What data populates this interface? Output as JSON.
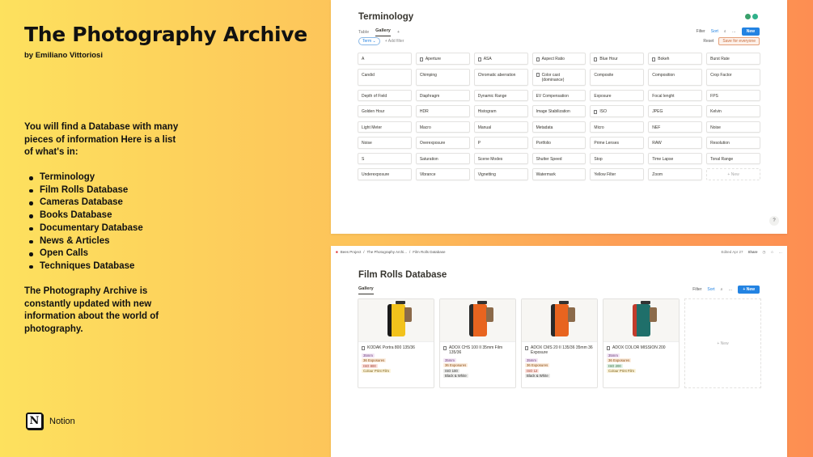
{
  "slide": {
    "title": "The Photography Archive",
    "byline": "by Emiliano Vittoriosi",
    "intro": "You will find a Database with many pieces of information Here is a list of what's in:",
    "items": [
      "Terminology",
      "Film Rolls Database",
      "Cameras Database",
      "Books Database",
      "Documentary Database",
      "News & Articles",
      "Open Calls",
      "Techniques Database"
    ],
    "outro": "The Photography Archive is constantly updated with new information about the world of photography.",
    "brand": "Notion"
  },
  "terminology": {
    "title": "Terminology",
    "tabs": [
      "Table",
      "Gallery",
      "+"
    ],
    "filter": "Filter",
    "sort": "Sort",
    "new": "New",
    "chip": "Term ⌄",
    "add_filter": "+ Add filter",
    "reset": "Reset",
    "save": "Save for everyone",
    "cards": [
      [
        "A",
        0
      ],
      [
        "Aperture",
        1
      ],
      [
        "ASA",
        1
      ],
      [
        "Aspect Ratio",
        1
      ],
      [
        "Blue Hour",
        1
      ],
      [
        "Bokeh",
        1
      ],
      [
        "Burst Rate",
        0
      ],
      [
        "Candid",
        0
      ],
      [
        "Chimping",
        0
      ],
      [
        "Chromatic aberration",
        0
      ],
      [
        "Color cast (dominance)",
        1
      ],
      [
        "Composite",
        0
      ],
      [
        "Composition",
        0
      ],
      [
        "Crop Factor",
        0
      ],
      [
        "Depth of Field",
        0
      ],
      [
        "Diaphragm",
        0
      ],
      [
        "Dynamic Range",
        0
      ],
      [
        "EV Compensation",
        0
      ],
      [
        "Exposure",
        0
      ],
      [
        "Focal lenght",
        0
      ],
      [
        "FPS",
        0
      ],
      [
        "Golden Hour",
        0
      ],
      [
        "HDR",
        0
      ],
      [
        "Histogram",
        0
      ],
      [
        "Image Stabilization",
        0
      ],
      [
        "ISO",
        1
      ],
      [
        "JPEG",
        0
      ],
      [
        "Kelvin",
        0
      ],
      [
        "Light Meter",
        0
      ],
      [
        "Macro",
        0
      ],
      [
        "Manual",
        0
      ],
      [
        "Metadata",
        0
      ],
      [
        "Micro",
        0
      ],
      [
        "NEF",
        0
      ],
      [
        "Noise",
        0
      ],
      [
        "Noise",
        0
      ],
      [
        "Overexposure",
        0
      ],
      [
        "P",
        0
      ],
      [
        "Portfolio",
        0
      ],
      [
        "Prime Lenses",
        0
      ],
      [
        "RAW",
        0
      ],
      [
        "Resolution",
        0
      ],
      [
        "S",
        0
      ],
      [
        "Saturation",
        0
      ],
      [
        "Scene Modes",
        0
      ],
      [
        "Shutter Speed",
        0
      ],
      [
        "Stop",
        0
      ],
      [
        "Time Lapse",
        0
      ],
      [
        "Tonal Range",
        0
      ],
      [
        "Underexposure",
        0
      ],
      [
        "Vibrance",
        0
      ],
      [
        "Vignetting",
        0
      ],
      [
        "Watermark",
        0
      ],
      [
        "Yellow Filter",
        0
      ],
      [
        "Zoom",
        0
      ],
      [
        "+ New",
        0
      ]
    ],
    "help": "?"
  },
  "filmrolls": {
    "breadcrumb": [
      "Bees Project",
      "/",
      "The Photography Archi...",
      "/",
      "Film Rolls Database"
    ],
    "edited": "Edited Apr 27",
    "share": "Share",
    "title": "Film Rolls Database",
    "tab": "Gallery",
    "filter": "Filter",
    "sort": "Sort",
    "new": "+ New",
    "cards": [
      {
        "name": "KODAK Portra 800 135/36",
        "tags": [
          [
            "35mm",
            "t1"
          ],
          [
            "36 Exposures",
            "t2"
          ],
          [
            "ISO 800",
            "t3"
          ],
          [
            "Colour Print Film",
            "t4"
          ]
        ],
        "color": "#f2c21c",
        "band": "#1a1a1a"
      },
      {
        "name": "ADOX CHS 100 II 35mm Film 135/36",
        "tags": [
          [
            "35mm",
            "t1"
          ],
          [
            "36 Exposures",
            "t2"
          ],
          [
            "ISO 100",
            "t5"
          ],
          [
            "Black & White",
            "t5"
          ]
        ],
        "color": "#e8641f",
        "band": "#2a2a2a"
      },
      {
        "name": "ADOX CMS 20 II 135/36 35mm 36 Exposure",
        "tags": [
          [
            "35mm",
            "t1"
          ],
          [
            "36 Exposures",
            "t2"
          ],
          [
            "ISO 12",
            "t3"
          ],
          [
            "Black & White",
            "t5"
          ]
        ],
        "color": "#e8641f",
        "band": "#2a2a2a"
      },
      {
        "name": "ADOX COLOR MISSION 200",
        "tags": [
          [
            "35mm",
            "t1"
          ],
          [
            "36 Exposures",
            "t2"
          ],
          [
            "ISO 200",
            "t6"
          ],
          [
            "Colour Print Film",
            "t4"
          ]
        ],
        "color": "#1f6f6a",
        "band": "#c23c2c"
      }
    ]
  }
}
